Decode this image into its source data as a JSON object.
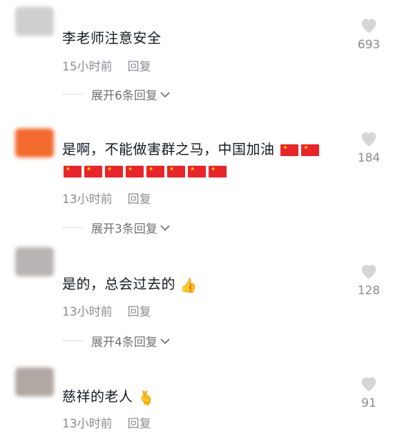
{
  "comments": [
    {
      "text": "李老师注意安全",
      "time": "15小时前",
      "reply": "回复",
      "likes": "693",
      "expand": "展开6条回复",
      "avatar_color": "#cfcfcf"
    },
    {
      "text": "是啊，不能做害群之马，中国加油",
      "time": "13小时前",
      "reply": "回复",
      "likes": "184",
      "expand": "展开3条回复",
      "avatar_color": "#f26a2d"
    },
    {
      "text": "是的，总会过去的",
      "time": "13小时前",
      "reply": "回复",
      "likes": "128",
      "expand": "展开4条回复",
      "avatar_color": "#b8b4b4"
    },
    {
      "text": "慈祥的老人",
      "time": "13小时前",
      "reply": "回复",
      "likes": "91",
      "avatar_color": "#b2a8a3"
    }
  ],
  "icons": {
    "heart": "heart-icon",
    "chevron": "chevron-down-icon",
    "flag": "china-flag-emoji",
    "thumbs_up": "thumbs-up-emoji",
    "crossed_fingers_heart": "finger-heart-emoji"
  },
  "colors": {
    "text": "#161823",
    "meta": "#8a8b91",
    "flag_red": "#e7252b"
  }
}
